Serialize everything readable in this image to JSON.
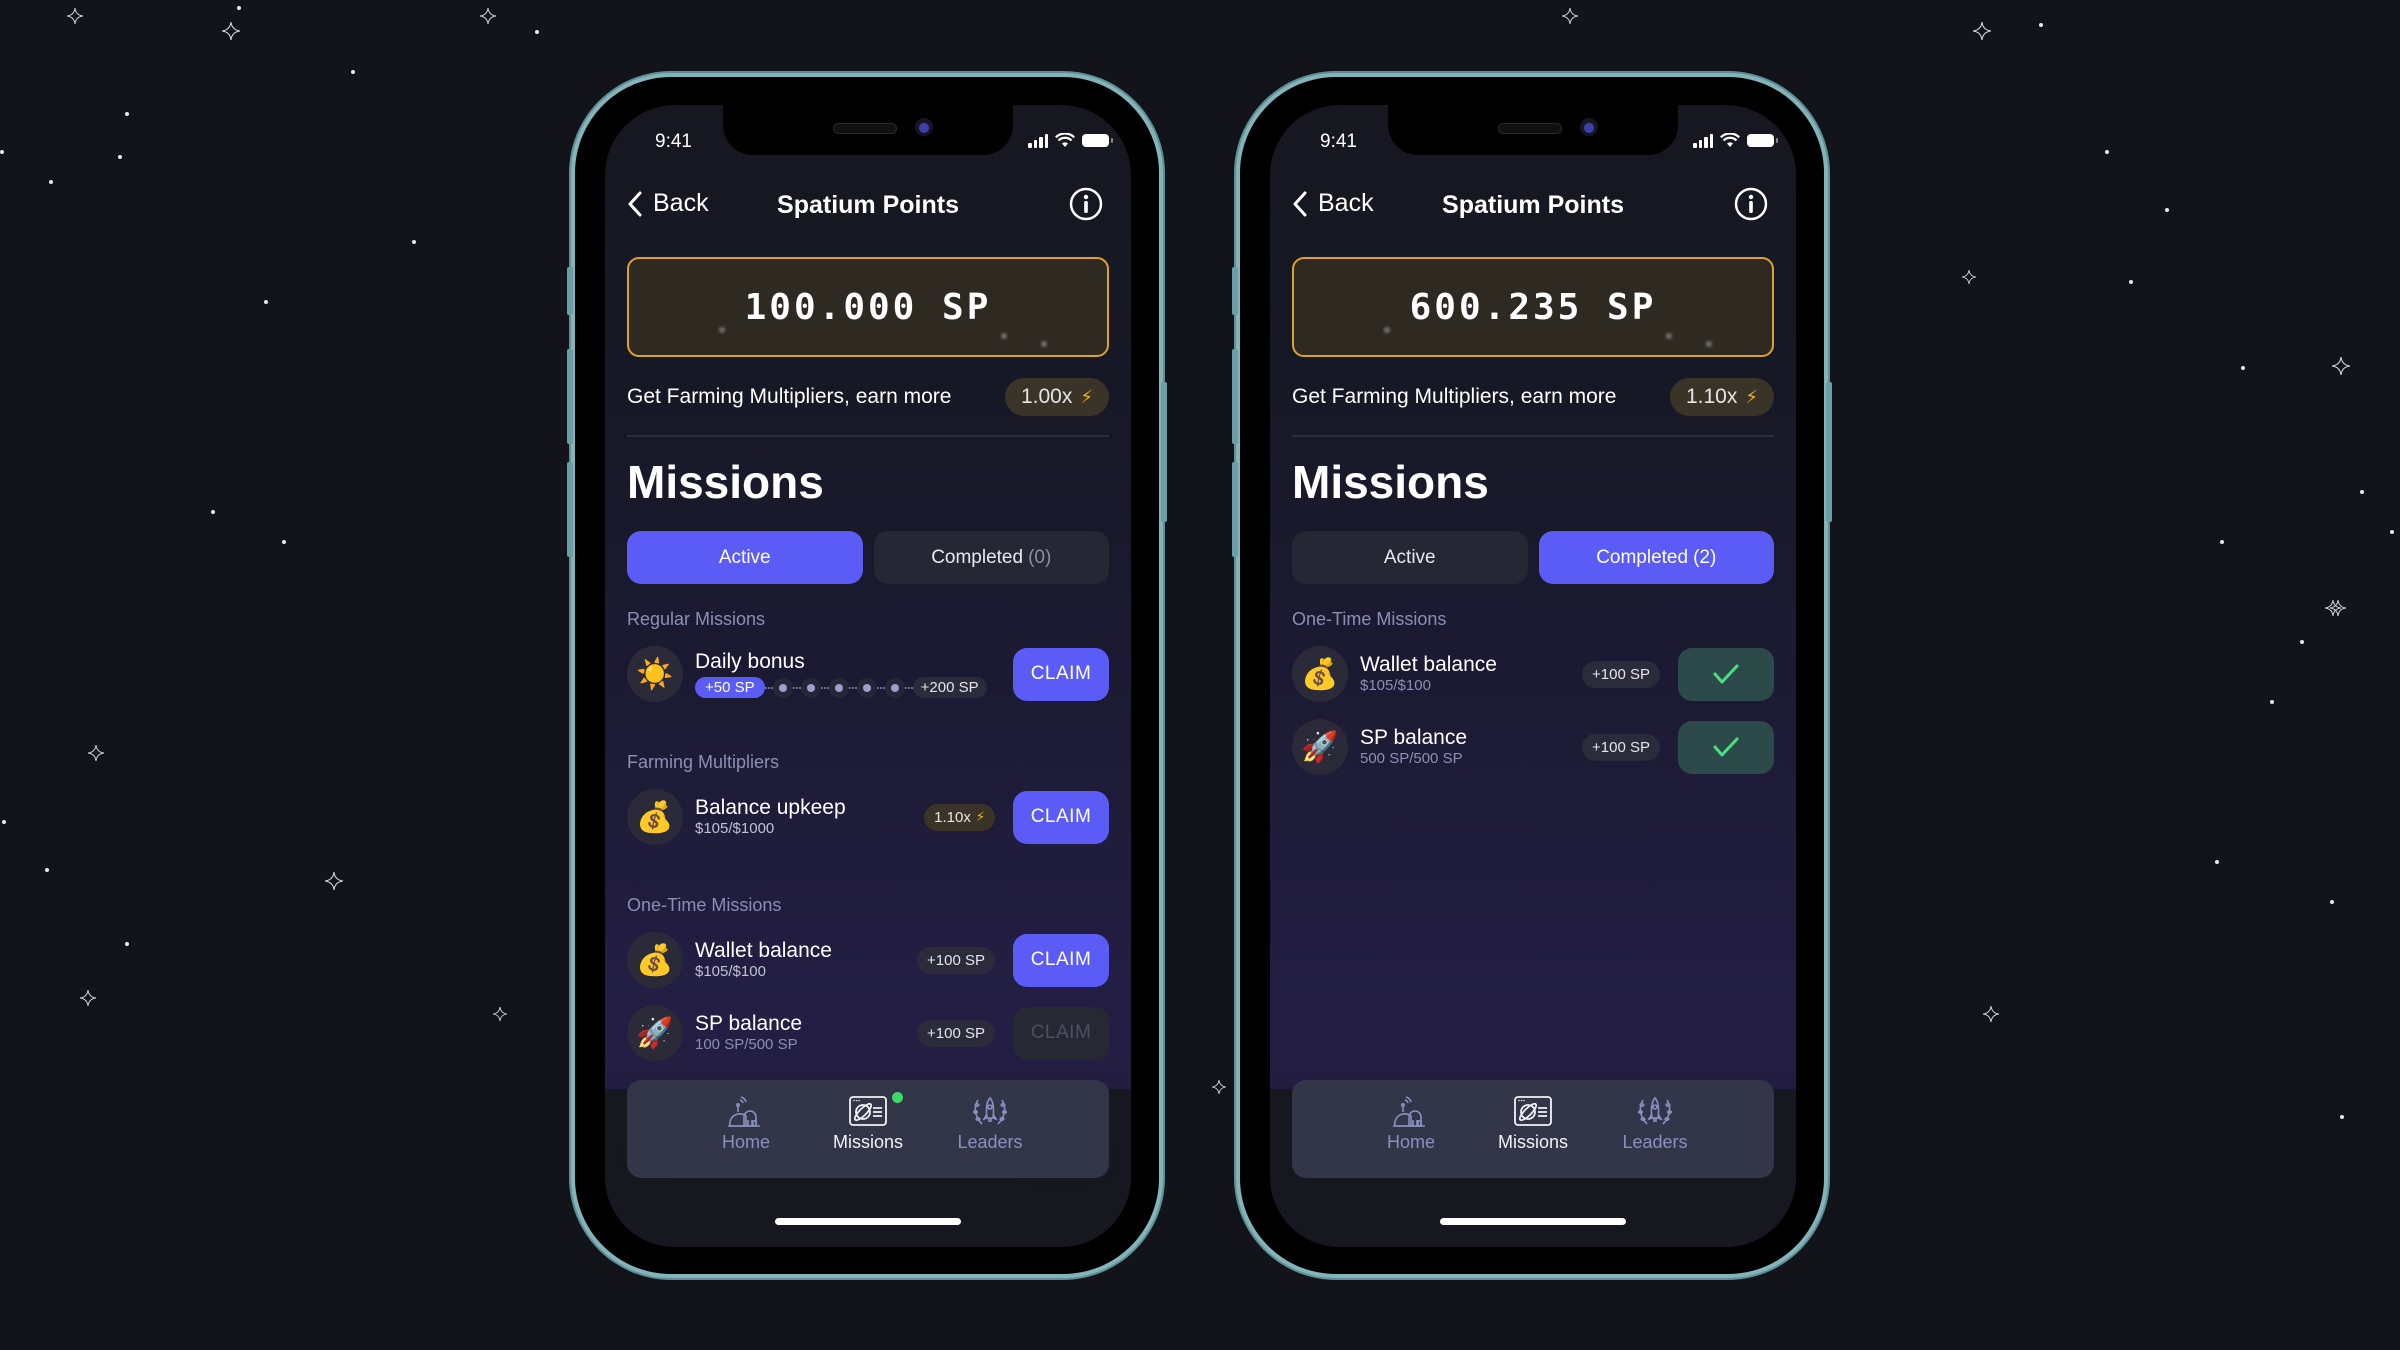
{
  "colors": {
    "background": "#121419",
    "accent": "#5b5bf6",
    "balance_border": "#e0a030",
    "success": "#4ade80",
    "notification": "#3ed96a",
    "bolt": "#f5b021"
  },
  "phones": [
    {
      "status_bar": {
        "time": "9:41"
      },
      "nav": {
        "back_label": "Back",
        "title": "Spatium Points",
        "info_icon": "info-icon"
      },
      "balance": "100.000 SP",
      "farming": {
        "text": "Get Farming Multipliers, earn more",
        "multiplier": "1.00x"
      },
      "missions_title": "Missions",
      "tabs": [
        {
          "label": "Active",
          "count": "",
          "active": true
        },
        {
          "label": "Completed",
          "count": "(0)",
          "active": false
        }
      ],
      "sections": {
        "regular": {
          "title": "Regular Missions",
          "items": [
            {
              "icon": "sun-icon",
              "emoji": "☀️",
              "name": "Daily bonus",
              "progress_start": "+50 SP",
              "progress_end": "+200 SP",
              "progress_steps": 5,
              "action": "CLAIM"
            }
          ]
        },
        "farming": {
          "title": "Farming Multipliers",
          "items": [
            {
              "icon": "money-bag-icon",
              "emoji": "💰",
              "name": "Balance upkeep",
              "sub": "$105/$1000",
              "reward": "1.10x",
              "action": "CLAIM"
            }
          ]
        },
        "one_time": {
          "title": "One-Time Missions",
          "items": [
            {
              "icon": "money-bag-icon",
              "emoji": "💰",
              "name": "Wallet balance",
              "sub": "$105/$100",
              "reward": "+100 SP",
              "action": "CLAIM",
              "enabled": true
            },
            {
              "icon": "rocket-icon",
              "emoji": "🚀",
              "name": "SP balance",
              "sub": "100 SP/500 SP",
              "reward": "+100 SP",
              "action": "CLAIM",
              "enabled": false
            }
          ]
        }
      },
      "tabbar": [
        {
          "label": "Home",
          "icon": "home-dome-icon",
          "active": false
        },
        {
          "label": "Missions",
          "icon": "missions-card-icon",
          "active": true,
          "notification": true
        },
        {
          "label": "Leaders",
          "icon": "leaders-laurel-icon",
          "active": false
        }
      ]
    },
    {
      "status_bar": {
        "time": "9:41"
      },
      "nav": {
        "back_label": "Back",
        "title": "Spatium Points",
        "info_icon": "info-icon"
      },
      "balance": "600.235 SP",
      "farming": {
        "text": "Get Farming Multipliers, earn more",
        "multiplier": "1.10x"
      },
      "missions_title": "Missions",
      "tabs": [
        {
          "label": "Active",
          "count": "",
          "active": false
        },
        {
          "label": "Completed",
          "count": "(2)",
          "active": true
        }
      ],
      "sections": {
        "one_time": {
          "title": "One-Time Missions",
          "items": [
            {
              "icon": "money-bag-icon",
              "emoji": "💰",
              "name": "Wallet balance",
              "sub": "$105/$100",
              "reward": "+100 SP",
              "status": "completed"
            },
            {
              "icon": "rocket-icon",
              "emoji": "🚀",
              "name": "SP balance",
              "sub": "500 SP/500 SP",
              "reward": "+100 SP",
              "status": "completed"
            }
          ]
        }
      },
      "tabbar": [
        {
          "label": "Home",
          "icon": "home-dome-icon",
          "active": false
        },
        {
          "label": "Missions",
          "icon": "missions-card-icon",
          "active": true,
          "notification": false
        },
        {
          "label": "Leaders",
          "icon": "leaders-laurel-icon",
          "active": false
        }
      ]
    }
  ]
}
